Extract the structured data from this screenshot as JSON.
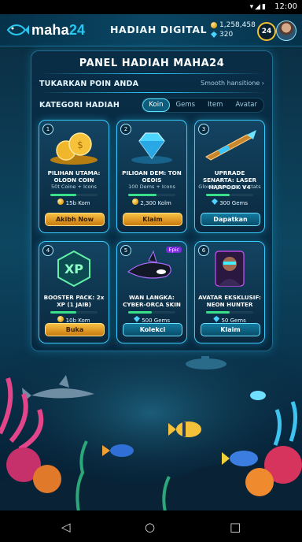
{
  "status": {
    "time": "12:00"
  },
  "header": {
    "logo_prefix": "maha",
    "logo_suffix": "24",
    "title": "HADIAH DIGITAL",
    "coins": "1,258,458",
    "gems": "320",
    "level": "24"
  },
  "panel": {
    "title": "PANEL HADIAH MAHA24",
    "redeem_label": "TUKARKAN POIN ANDA",
    "redeem_hint": "Smooth hansitione",
    "category_label": "KATEGORI HADIAH",
    "tabs": [
      "Koin",
      "Gems",
      "Item",
      "Avatar"
    ],
    "active_tab": "Koin"
  },
  "cards": [
    {
      "num": "1",
      "title": "PILIHAN UTAMA: OLODN COIN",
      "sub": "50t Coine + Icons",
      "progress": 0.55,
      "cost": "15b Kom",
      "button": "Akibh Now",
      "style": "gold"
    },
    {
      "num": "2",
      "title": "PILIOAN DEM: TON OEOIS",
      "sub": "100 Dems + Icons",
      "progress": 0.6,
      "cost": "2,300 Kolm",
      "button": "Klaim",
      "style": "gold"
    },
    {
      "num": "3",
      "title": "UPRRADE SENARTA: LASER HARPOOK V4",
      "sub": "Glowing weapon + ctats",
      "progress": 0.5,
      "cost": "300 Gems",
      "button": "Dapatkan",
      "style": "cyan"
    },
    {
      "num": "4",
      "title": "BOOSTER PACK: 2x XP (1 JAIB)",
      "sub": "",
      "progress": 0.55,
      "cost": "10b Kom",
      "button": "Buka",
      "style": "gold"
    },
    {
      "num": "5",
      "title": "WAN LANGKA: CYBER-ORCA SKIN",
      "sub": "",
      "badge": "Epic",
      "progress": 0.5,
      "cost": "500 Gems",
      "button": "Kolekci",
      "style": "cyan"
    },
    {
      "num": "6",
      "title": "AVATAR EKSKLUSIF: NEON HUNTER",
      "sub": "",
      "progress": 0.5,
      "cost": "50 Gems",
      "button": "Klaim",
      "style": "cyan"
    }
  ]
}
